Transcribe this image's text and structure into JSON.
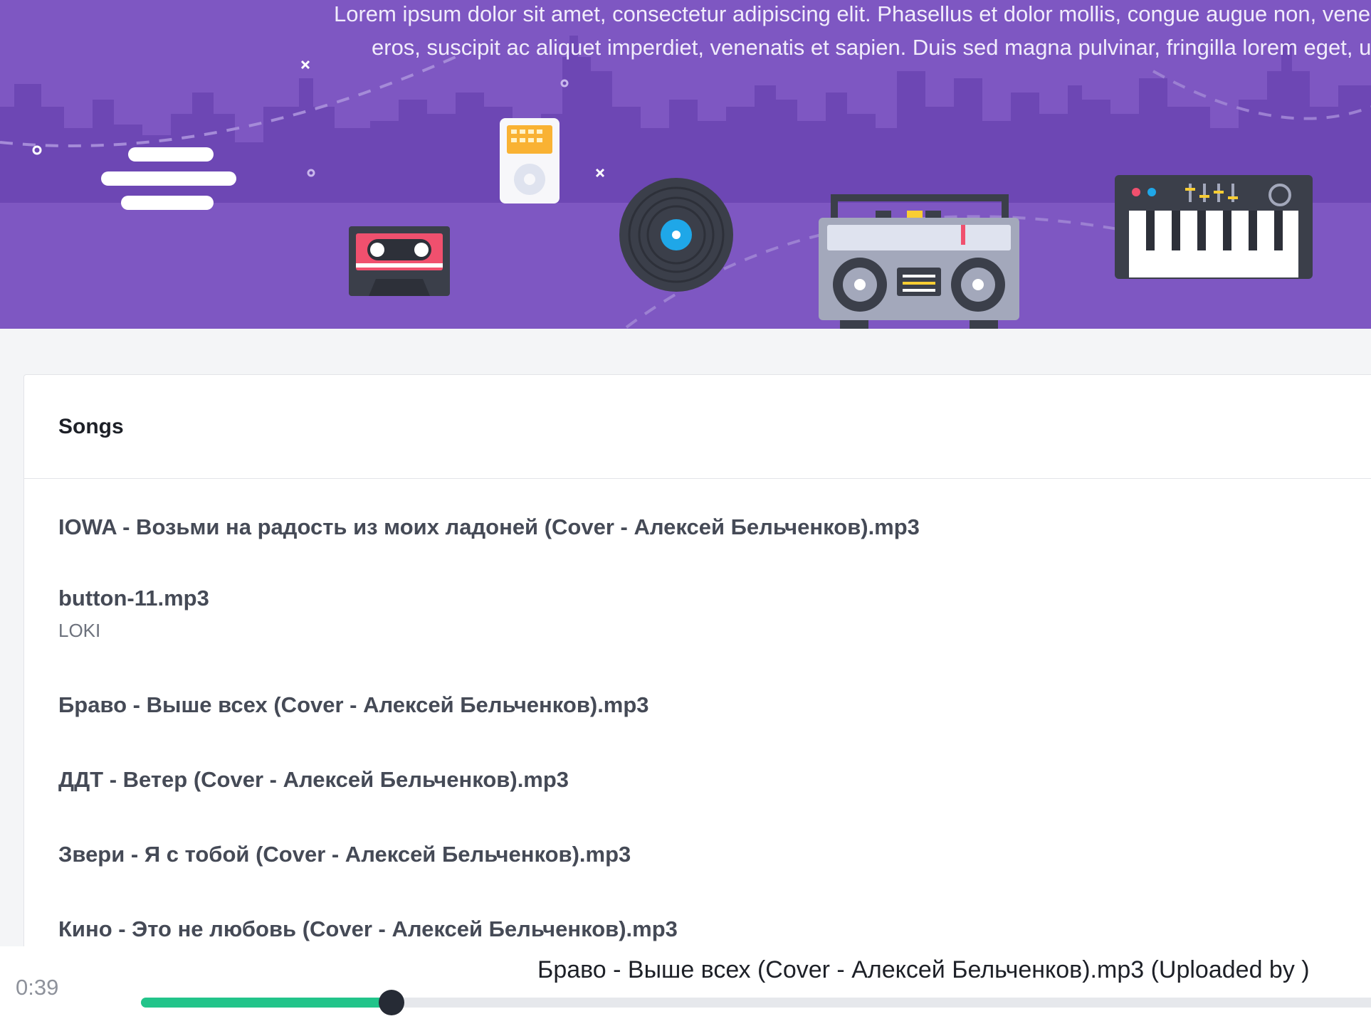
{
  "hero": {
    "lines": [
      "Lorem ipsum dolor sit amet, consectetur adipiscing elit. Phasellus et dolor mollis, congue augue non, venenatis",
      "eros, suscipit ac aliquet imperdiet, venenatis et sapien. Duis sed magna pulvinar, fringilla lorem eget, ullam"
    ]
  },
  "songs": {
    "title": "Songs",
    "items": [
      {
        "name": "IOWA - Возьми на радость из моих ладоней (Cover - Алексей Бельченков).mp3"
      },
      {
        "name": "button-11.mp3",
        "uploader": "LOKI"
      },
      {
        "name": "Браво - Выше всех (Cover - Алексей Бельченков).mp3"
      },
      {
        "name": "ДДТ - Ветер (Cover - Алексей Бельченков).mp3"
      },
      {
        "name": "Звери - Я с тобой (Cover - Алексей Бельченков).mp3"
      },
      {
        "name": "Кино - Это не любовь (Cover - Алексей Бельченков).mp3"
      }
    ]
  },
  "player": {
    "current_time": "0:39",
    "now_playing": "Браво - Выше всех (Cover - Алексей Бельченков).mp3 (Uploaded by )",
    "progress_fraction": 0.2
  },
  "colors": {
    "hero_bg": "#7e57c2",
    "progress_fill": "#22c48a",
    "progress_knob": "#262b35"
  },
  "icons": [
    "cloud-icon",
    "cassette-icon",
    "ipod-icon",
    "vinyl-record-icon",
    "boombox-icon",
    "synthesizer-icon"
  ]
}
